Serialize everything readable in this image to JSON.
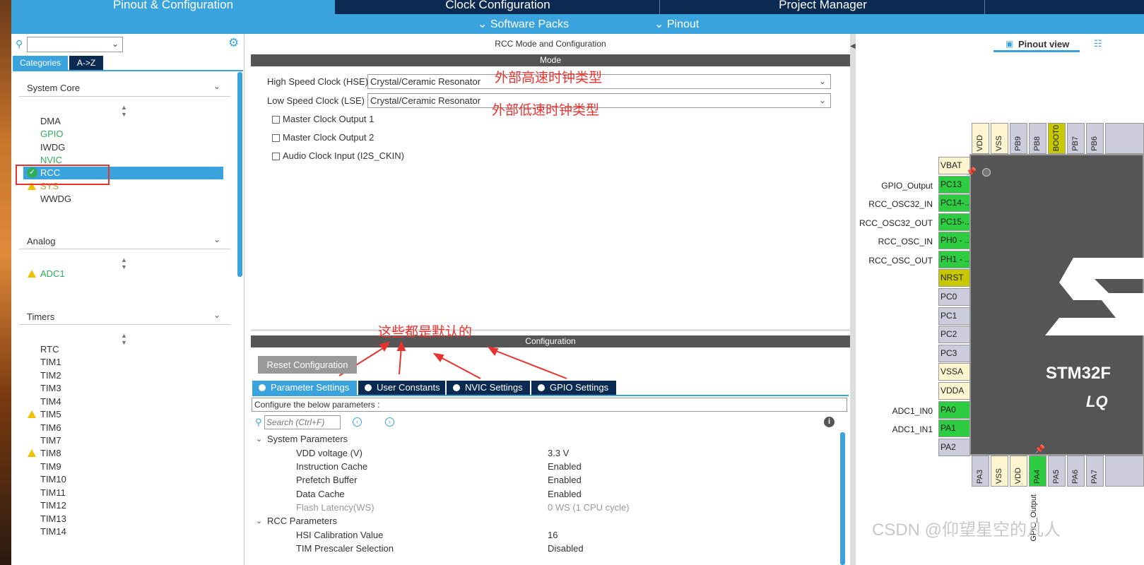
{
  "tabs": [
    "Pinout & Configuration",
    "Clock Configuration",
    "Project Manager"
  ],
  "subtabs": [
    "Software Packs",
    "Pinout"
  ],
  "left": {
    "categories_label": "Categories",
    "az_label": "A->Z",
    "groups": [
      {
        "title": "System Core",
        "items": [
          "DMA",
          "GPIO",
          "IWDG",
          "NVIC",
          "RCC",
          "SYS",
          "WWDG"
        ]
      },
      {
        "title": "Analog",
        "items": [
          "ADC1"
        ]
      },
      {
        "title": "Timers",
        "items": [
          "RTC",
          "TIM1",
          "TIM2",
          "TIM3",
          "TIM4",
          "TIM5",
          "TIM6",
          "TIM7",
          "TIM8",
          "TIM9",
          "TIM10",
          "TIM11",
          "TIM12",
          "TIM13",
          "TIM14"
        ]
      }
    ]
  },
  "rcc": {
    "title": "RCC Mode and Configuration",
    "mode_label": "Mode",
    "hse_label": "High Speed Clock (HSE)",
    "hse_value": "Crystal/Ceramic Resonator",
    "lse_label": "Low Speed Clock (LSE)",
    "lse_value": "Crystal/Ceramic Resonator",
    "mco1": "Master Clock Output 1",
    "mco2": "Master Clock Output 2",
    "i2s": "Audio Clock Input (I2S_CKIN)",
    "configuration_label": "Configuration",
    "reset_btn": "Reset Configuration",
    "config_tabs": [
      "Parameter Settings",
      "User Constants",
      "NVIC Settings",
      "GPIO Settings"
    ],
    "configure_text": "Configure the below parameters :",
    "search_placeholder": "Search (Ctrl+F)",
    "system_params_label": "System Parameters",
    "params": [
      {
        "name": "VDD voltage (V)",
        "value": "3.3 V"
      },
      {
        "name": "Instruction Cache",
        "value": "Enabled"
      },
      {
        "name": "Prefetch Buffer",
        "value": "Enabled"
      },
      {
        "name": "Data Cache",
        "value": "Enabled"
      },
      {
        "name": "Flash Latency(WS)",
        "value": "0 WS (1 CPU cycle)"
      }
    ],
    "rcc_params_label": "RCC Parameters",
    "rcc_params": [
      {
        "name": "HSI Calibration Value",
        "value": "16"
      },
      {
        "name": "TIM Prescaler Selection",
        "value": "Disabled"
      }
    ]
  },
  "annotations": {
    "hse_note": "外部高速时钟类型",
    "lse_note": "外部低速时钟类型",
    "default_note": "这些都是默认的"
  },
  "pinout": {
    "view_label": "Pinout view",
    "top_pins": [
      "VDD",
      "VSS",
      "PB9",
      "PB8",
      "BOOT0",
      "PB7",
      "PB6"
    ],
    "left_pins": [
      "VBAT",
      "PC13",
      "PC14-..",
      "PC15-..",
      "PH0 - ..",
      "PH1 - ..",
      "NRST",
      "PC0",
      "PC1",
      "PC2",
      "PC3",
      "VSSA",
      "VDDA",
      "PA0",
      "PA1",
      "PA2"
    ],
    "left_labels": [
      "GPIO_Output",
      "RCC_OSC32_IN",
      "RCC_OSC32_OUT",
      "RCC_OSC_IN",
      "RCC_OSC_OUT",
      "ADC1_IN0",
      "ADC1_IN1"
    ],
    "bottom_pins": [
      "PA3",
      "VSS",
      "VDD",
      "PA4",
      "PA5",
      "PA6",
      "PA7"
    ],
    "bottom_label": "GPIO_Output",
    "chip_name": "STM32F",
    "chip_pkg": "LQ",
    "colors": {
      "green": "#2ecc40",
      "cream": "#fdf5d0",
      "olive": "#c8c800",
      "gray": "#ccccdd"
    }
  },
  "watermark": "CSDN @仰望星空的凡人"
}
